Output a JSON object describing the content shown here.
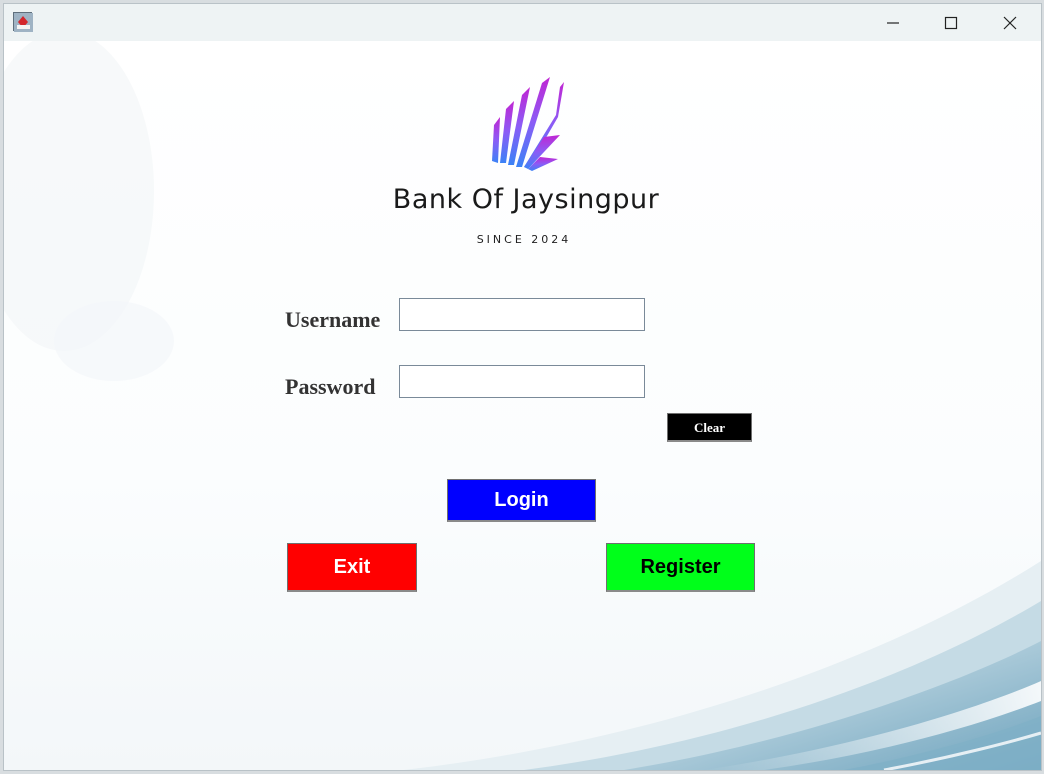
{
  "titlebar": {
    "icons": {
      "app": "java-app-icon",
      "minimize": "minimize-icon",
      "maximize": "maximize-icon",
      "close": "close-icon"
    }
  },
  "brand": {
    "name": "Bank Of Jaysingpur",
    "tagline": "SINCE 2024",
    "logo_colors": [
      "#c026d3",
      "#8b5cf6",
      "#3b82f6"
    ]
  },
  "form": {
    "username_label": "Username",
    "username_value": "",
    "password_label": "Password",
    "password_value": ""
  },
  "buttons": {
    "clear": "Clear",
    "login": "Login",
    "exit": "Exit",
    "register": "Register"
  },
  "colors": {
    "clear_bg": "#000000",
    "login_bg": "#0000ff",
    "exit_bg": "#ff0000",
    "register_bg": "#00ff1a"
  }
}
